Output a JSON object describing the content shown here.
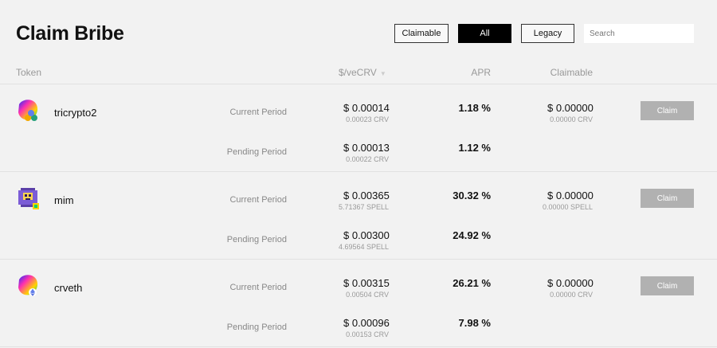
{
  "header": {
    "title": "Claim Bribe",
    "filters": [
      {
        "label": "Claimable",
        "active": false
      },
      {
        "label": "All",
        "active": true
      },
      {
        "label": "Legacy",
        "active": false
      }
    ],
    "search_placeholder": "Search"
  },
  "table": {
    "columns": {
      "token": "Token",
      "price": "$/veCRV",
      "apr": "APR",
      "claimable": "Claimable"
    },
    "rows": [
      {
        "name": "tricrypto2",
        "icon": "tricrypto2-token-icon",
        "current": {
          "label": "Current Period",
          "price": "$ 0.00014",
          "price_sub": "0.00023 CRV",
          "apr": "1.18 %",
          "claimable": "$ 0.00000",
          "claimable_sub": "0.00000 CRV",
          "claim_label": "Claim"
        },
        "pending": {
          "label": "Pending Period",
          "price": "$ 0.00013",
          "price_sub": "0.00022 CRV",
          "apr": "1.12 %"
        }
      },
      {
        "name": "mim",
        "icon": "mim-token-icon",
        "current": {
          "label": "Current Period",
          "price": "$ 0.00365",
          "price_sub": "5.71367 SPELL",
          "apr": "30.32 %",
          "claimable": "$ 0.00000",
          "claimable_sub": "0.00000 SPELL",
          "claim_label": "Claim"
        },
        "pending": {
          "label": "Pending Period",
          "price": "$ 0.00300",
          "price_sub": "4.69564 SPELL",
          "apr": "24.92 %"
        }
      },
      {
        "name": "crveth",
        "icon": "crveth-token-icon",
        "current": {
          "label": "Current Period",
          "price": "$ 0.00315",
          "price_sub": "0.00504 CRV",
          "apr": "26.21 %",
          "claimable": "$ 0.00000",
          "claimable_sub": "0.00000 CRV",
          "claim_label": "Claim"
        },
        "pending": {
          "label": "Pending Period",
          "price": "$ 0.00096",
          "price_sub": "0.00153 CRV",
          "apr": "7.98 %"
        }
      }
    ]
  }
}
